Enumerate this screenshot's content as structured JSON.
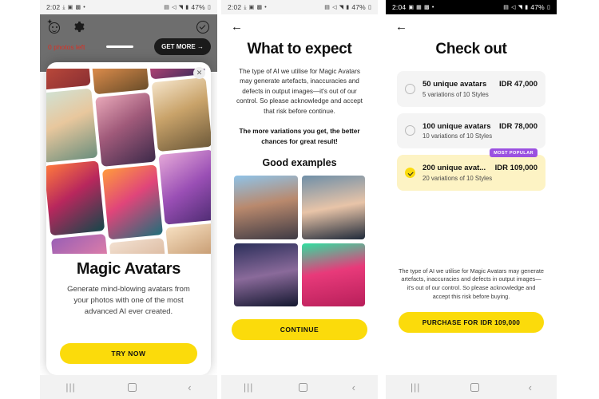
{
  "panels": {
    "one": {
      "status": {
        "time": "2:02",
        "battery": "47%"
      },
      "app": {
        "photos_left": "0 photos left",
        "get_more": "GET MORE  →"
      },
      "sheet": {
        "close": "✕",
        "title": "Magic Avatars",
        "subtitle": "Generate mind-blowing avatars from your photos with one of the most advanced AI ever created.",
        "cta": "TRY NOW"
      }
    },
    "two": {
      "status": {
        "time": "2:02",
        "battery": "47%"
      },
      "back": "←",
      "title": "What to expect",
      "paragraph": "The type of AI we utilise for Magic Avatars may generate artefacts, inaccuracies and defects in output images—it's out of our control. So please acknowledge and accept that risk before continue.",
      "emphasis": "The more variations you get, the better chances for great result!",
      "section_heading": "Good examples",
      "cta": "CONTINUE"
    },
    "three": {
      "status": {
        "time": "2:04",
        "battery": "47%"
      },
      "back": "←",
      "title": "Check out",
      "badge": "MOST POPULAR",
      "plans": [
        {
          "name": "50 unique avatars",
          "price": "IDR 47,000",
          "sub": "5 variations of 10 Styles",
          "selected": false
        },
        {
          "name": "100 unique avatars",
          "price": "IDR 78,000",
          "sub": "10 variations of 10 Styles",
          "selected": false
        },
        {
          "name": "200 unique avat...",
          "price": "IDR 109,000",
          "sub": "20 variations of 10 Styles",
          "selected": true
        }
      ],
      "disclaimer": "The type of AI we utilise for Magic Avatars may generate artefacts, inaccuracies and defects in output images—it's out of our control. So please acknowledge and accept this risk before buying.",
      "cta": "PURCHASE FOR IDR 109,000"
    }
  },
  "navbar": {
    "recents": "|||",
    "home": "",
    "back": "‹"
  },
  "colors": {
    "accent_yellow": "#fbdb0b",
    "badge_purple": "#9b51e0",
    "selected_card": "#fdf3c4",
    "card_grey": "#f4f4f4",
    "alert_red": "#d93025"
  }
}
